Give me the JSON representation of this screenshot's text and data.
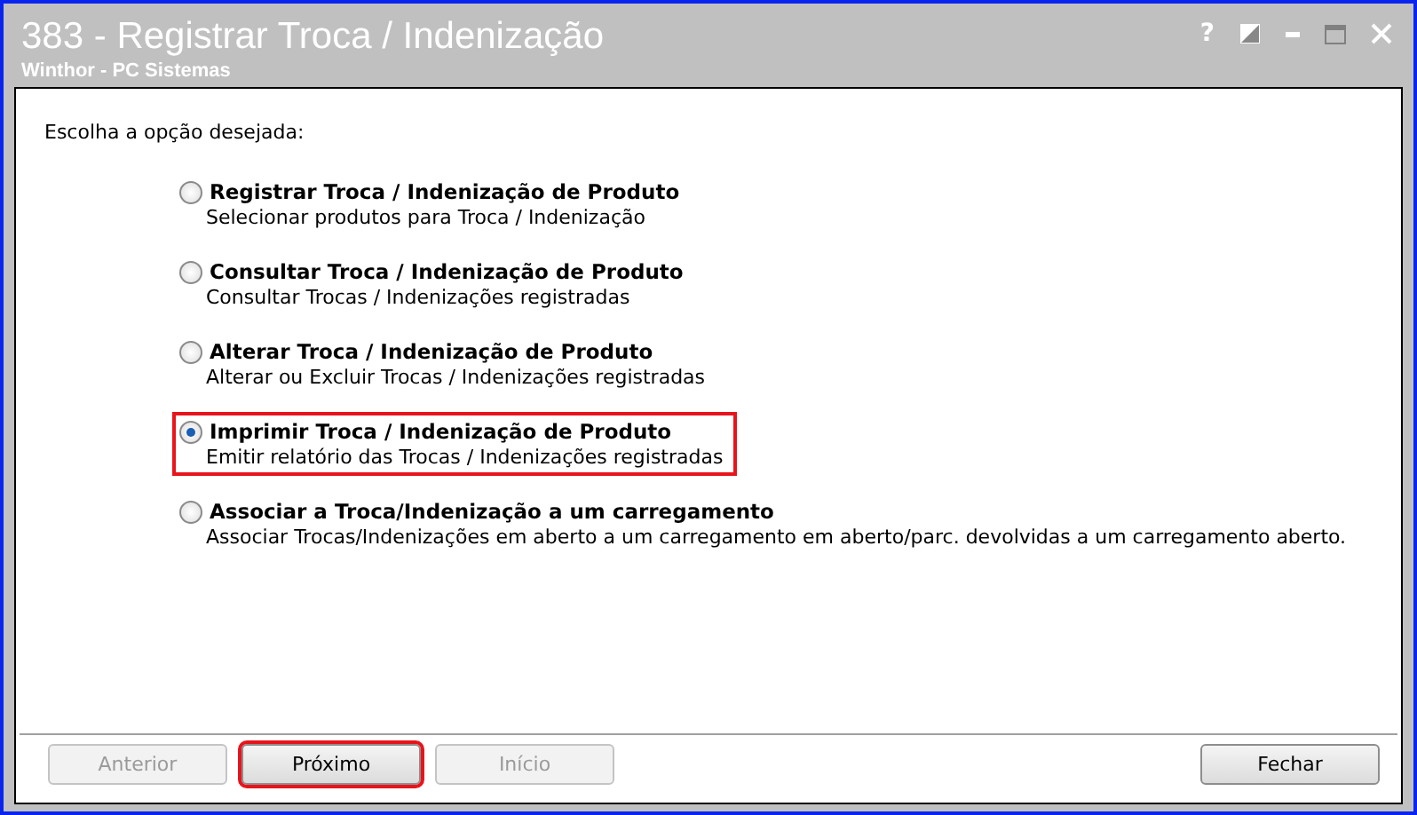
{
  "window": {
    "title": "383 - Registrar Troca / Indenização",
    "subtitle": "Winthor - PC Sistemas",
    "controls": [
      {
        "kind": "help",
        "label": "?"
      },
      {
        "kind": "theme"
      },
      {
        "kind": "minimize"
      },
      {
        "kind": "maximize"
      },
      {
        "kind": "close"
      }
    ]
  },
  "prompt": "Escolha a opção desejada:",
  "options": [
    {
      "label": "Registrar Troca / Indenização de Produto",
      "description": "Selecionar produtos para Troca / Indenização",
      "selected": false,
      "highlighted": false
    },
    {
      "label": "Consultar Troca / Indenização de Produto",
      "description": "Consultar Trocas / Indenizações registradas",
      "selected": false,
      "highlighted": false
    },
    {
      "label": "Alterar Troca / Indenização de Produto",
      "description": "Alterar ou Excluir Trocas / Indenizações registradas",
      "selected": false,
      "highlighted": false
    },
    {
      "label": "Imprimir Troca / Indenização de Produto",
      "description": "Emitir relatório das Trocas / Indenizações registradas",
      "selected": true,
      "highlighted": true
    },
    {
      "label": "Associar a Troca/Indenização a um carregamento",
      "description": "Associar Trocas/Indenizações em aberto a um carregamento em aberto/parc. devolvidas a um carregamento aberto.",
      "selected": false,
      "highlighted": false
    }
  ],
  "buttons": [
    {
      "label": "Anterior",
      "disabled": true,
      "highlighted": false
    },
    {
      "label": "Próximo",
      "disabled": false,
      "highlighted": true
    },
    {
      "label": "Início",
      "disabled": true,
      "highlighted": false
    },
    {
      "label": "Fechar",
      "disabled": false,
      "highlighted": false
    }
  ]
}
